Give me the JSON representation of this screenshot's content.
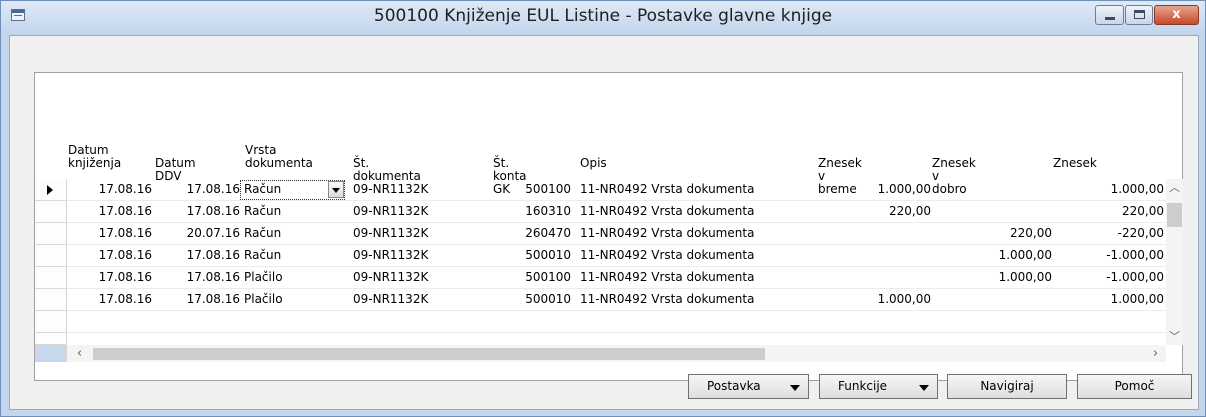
{
  "window": {
    "title": "500100 Knjiženje EUL Listine - Postavke glavne knjige",
    "min_label": "",
    "max_label": "",
    "close_label": "x"
  },
  "grid": {
    "columns": [
      {
        "key": "datum_knjizenja",
        "label_line1": "Datum",
        "label_line2": "knjiženja"
      },
      {
        "key": "datum_ddv",
        "label_line1": "",
        "label_line2": "Datum DDV"
      },
      {
        "key": "vrsta_dokumenta",
        "label_line1": "Vrsta",
        "label_line2": "dokumenta"
      },
      {
        "key": "st_dokumenta",
        "label_line1": "",
        "label_line2": "Št. dokumenta"
      },
      {
        "key": "st_konta_gk",
        "label_line1": "",
        "label_line2": "Št. konta GK"
      },
      {
        "key": "opis",
        "label_line1": "",
        "label_line2": "Opis"
      },
      {
        "key": "znesek_v_breme",
        "label_line1": "",
        "label_line2": "Znesek v breme"
      },
      {
        "key": "znesek_v_dobro",
        "label_line1": "",
        "label_line2": "Znesek v dobro"
      },
      {
        "key": "znesek",
        "label_line1": "",
        "label_line2": "Znesek"
      }
    ],
    "rows": [
      {
        "datum_knjizenja": "17.08.16",
        "datum_ddv": "17.08.16",
        "vrsta_dokumenta": "Račun",
        "st_dokumenta": "09-NR1132K",
        "st_konta_gk": "500100",
        "opis": "11-NR0492 Vrsta dokumenta",
        "znesek_v_breme": "1.000,00",
        "znesek_v_dobro": "",
        "znesek": "1.000,00"
      },
      {
        "datum_knjizenja": "17.08.16",
        "datum_ddv": "17.08.16",
        "vrsta_dokumenta": "Račun",
        "st_dokumenta": "09-NR1132K",
        "st_konta_gk": "160310",
        "opis": "11-NR0492 Vrsta dokumenta",
        "znesek_v_breme": "220,00",
        "znesek_v_dobro": "",
        "znesek": "220,00"
      },
      {
        "datum_knjizenja": "17.08.16",
        "datum_ddv": "20.07.16",
        "vrsta_dokumenta": "Račun",
        "st_dokumenta": "09-NR1132K",
        "st_konta_gk": "260470",
        "opis": "11-NR0492 Vrsta dokumenta",
        "znesek_v_breme": "",
        "znesek_v_dobro": "220,00",
        "znesek": "-220,00"
      },
      {
        "datum_knjizenja": "17.08.16",
        "datum_ddv": "17.08.16",
        "vrsta_dokumenta": "Račun",
        "st_dokumenta": "09-NR1132K",
        "st_konta_gk": "500010",
        "opis": "11-NR0492 Vrsta dokumenta",
        "znesek_v_breme": "",
        "znesek_v_dobro": "1.000,00",
        "znesek": "-1.000,00"
      },
      {
        "datum_knjizenja": "17.08.16",
        "datum_ddv": "17.08.16",
        "vrsta_dokumenta": "Plačilo",
        "st_dokumenta": "09-NR1132K",
        "st_konta_gk": "500100",
        "opis": "11-NR0492 Vrsta dokumenta",
        "znesek_v_breme": "",
        "znesek_v_dobro": "1.000,00",
        "znesek": "-1.000,00"
      },
      {
        "datum_knjizenja": "17.08.16",
        "datum_ddv": "17.08.16",
        "vrsta_dokumenta": "Plačilo",
        "st_dokumenta": "09-NR1132K",
        "st_konta_gk": "500010",
        "opis": "11-NR0492 Vrsta dokumenta",
        "znesek_v_breme": "1.000,00",
        "znesek_v_dobro": "",
        "znesek": "1.000,00"
      }
    ]
  },
  "buttons": {
    "postavka": "Postavka",
    "funkcije": "Funkcije",
    "navigiraj": "Navigiraj",
    "pomoc": "Pomoč"
  },
  "icons": {
    "app": "window-grid-icon",
    "row_marker": "current-row-arrow-icon",
    "dropdown": "chevron-down-icon",
    "scroll_up": "chevron-up-icon",
    "scroll_down": "chevron-down-icon",
    "scroll_left": "chevron-left-icon",
    "scroll_right": "chevron-right-icon"
  },
  "colors": {
    "title_bar": "#c5d7ee",
    "close_button": "#c6492b"
  }
}
